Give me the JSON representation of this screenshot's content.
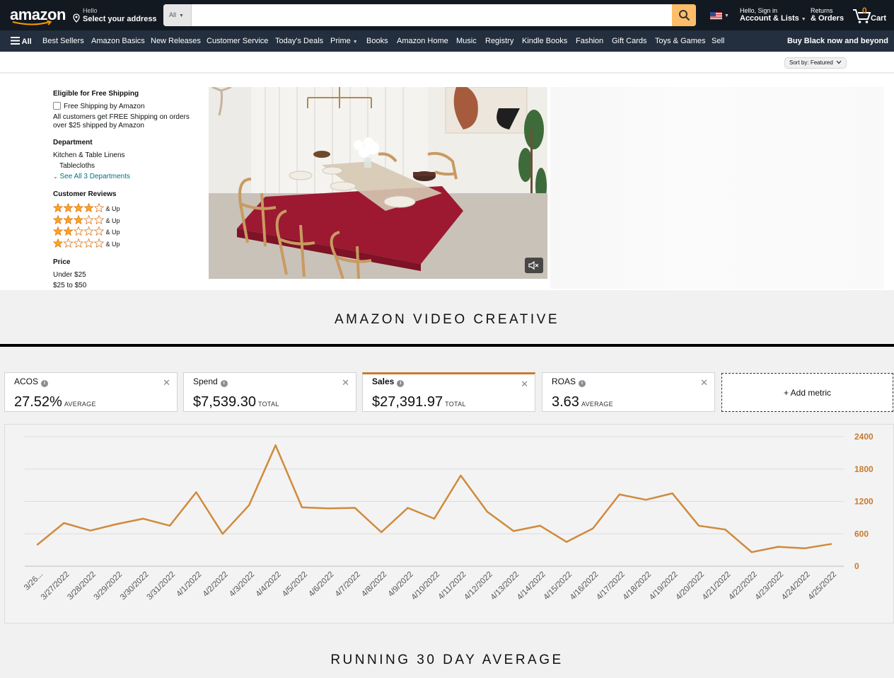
{
  "header": {
    "logo": "amazon",
    "address_line1": "Hello",
    "address_line2": "Select your address",
    "search_category": "All",
    "search_value": "",
    "account_line1": "Hello, Sign in",
    "account_line2": "Account & Lists",
    "returns_line1": "Returns",
    "returns_line2": "& Orders",
    "cart_count": "0",
    "cart_label": "Cart"
  },
  "nav": {
    "all": "All",
    "items": [
      "Best Sellers",
      "Amazon Basics",
      "New Releases",
      "Customer Service",
      "Today's Deals",
      "Prime",
      "Books",
      "Amazon Home",
      "Music",
      "Registry",
      "Kindle Books",
      "Fashion",
      "Gift Cards",
      "Toys & Games",
      "Sell"
    ],
    "promo": "Buy Black now and beyond"
  },
  "sort": {
    "label": "Sort by:",
    "value": "Featured"
  },
  "sidebar": {
    "shipping_heading": "Eligible for Free Shipping",
    "shipping_option": "Free Shipping by Amazon",
    "shipping_note_1": "All customers get FREE Shipping on orders",
    "shipping_note_2": "over $25 shipped by Amazon",
    "department_heading": "Department",
    "dept_1": "Kitchen & Table Linens",
    "dept_2": "Tablecloths",
    "see_all": "See All 3 Departments",
    "reviews_heading": "Customer Reviews",
    "review_rows": [
      {
        "stars": 4,
        "label": "& Up"
      },
      {
        "stars": 3,
        "label": "& Up"
      },
      {
        "stars": 2,
        "label": "& Up"
      },
      {
        "stars": 1,
        "label": "& Up"
      }
    ],
    "price_heading": "Price",
    "price_1": "Under $25",
    "price_2": "$25 to $50"
  },
  "captions": {
    "top": "AMAZON VIDEO CREATIVE",
    "bottom": "RUNNING 30 DAY AVERAGE"
  },
  "metrics": [
    {
      "name": "ACOS",
      "value": "27.52%",
      "unit": "AVERAGE"
    },
    {
      "name": "Spend",
      "value": "$7,539.30",
      "unit": "TOTAL"
    },
    {
      "name": "Sales",
      "value": "$27,391.97",
      "unit": "TOTAL"
    },
    {
      "name": "ROAS",
      "value": "3.63",
      "unit": "AVERAGE"
    }
  ],
  "add_metric": "+ Add metric",
  "colors": {
    "accent": "#c87b2e",
    "line": "#d08a3c",
    "header": "#131921",
    "nav": "#232f3e",
    "search_button": "#febd69"
  },
  "chart_data": {
    "type": "line",
    "x": [
      "3/26...",
      "3/27/2022",
      "3/28/2022",
      "3/29/2022",
      "3/30/2022",
      "3/31/2022",
      "4/1/2022",
      "4/2/2022",
      "4/3/2022",
      "4/4/2022",
      "4/5/2022",
      "4/6/2022",
      "4/7/2022",
      "4/8/2022",
      "4/9/2022",
      "4/10/2022",
      "4/11/2022",
      "4/12/2022",
      "4/13/2022",
      "4/14/2022",
      "4/15/2022",
      "4/16/2022",
      "4/17/2022",
      "4/18/2022",
      "4/19/2022",
      "4/20/2022",
      "4/21/2022",
      "4/22/2022",
      "4/23/2022",
      "4/24/2022",
      "4/25/2022"
    ],
    "series": [
      {
        "values": [
          400,
          800,
          660,
          780,
          880,
          750,
          1370,
          600,
          1130,
          2240,
          1090,
          1070,
          1080,
          630,
          1080,
          880,
          1680,
          1010,
          650,
          750,
          450,
          700,
          1330,
          1230,
          1350,
          750,
          680,
          260,
          360,
          330,
          410
        ]
      }
    ],
    "yticks": [
      0,
      600,
      1200,
      1800,
      2400
    ],
    "ylim": [
      0,
      2400
    ],
    "y_axis_side": "right",
    "grid": true
  }
}
